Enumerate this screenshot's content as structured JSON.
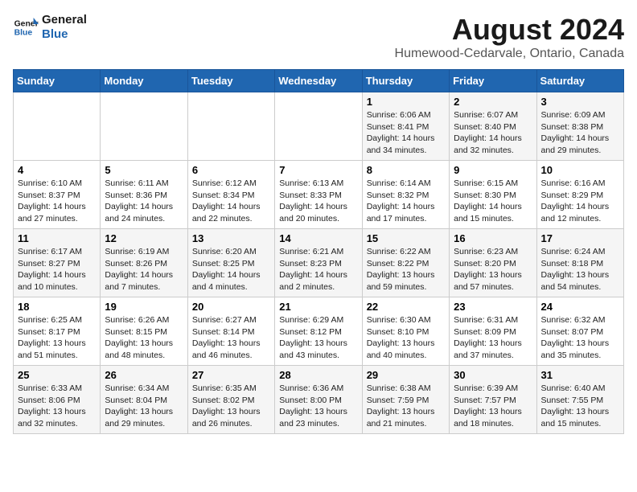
{
  "logo": {
    "line1": "General",
    "line2": "Blue"
  },
  "title": "August 2024",
  "subtitle": "Humewood-Cedarvale, Ontario, Canada",
  "days_of_week": [
    "Sunday",
    "Monday",
    "Tuesday",
    "Wednesday",
    "Thursday",
    "Friday",
    "Saturday"
  ],
  "weeks": [
    [
      {
        "day": "",
        "info": ""
      },
      {
        "day": "",
        "info": ""
      },
      {
        "day": "",
        "info": ""
      },
      {
        "day": "",
        "info": ""
      },
      {
        "day": "1",
        "info": "Sunrise: 6:06 AM\nSunset: 8:41 PM\nDaylight: 14 hours\nand 34 minutes."
      },
      {
        "day": "2",
        "info": "Sunrise: 6:07 AM\nSunset: 8:40 PM\nDaylight: 14 hours\nand 32 minutes."
      },
      {
        "day": "3",
        "info": "Sunrise: 6:09 AM\nSunset: 8:38 PM\nDaylight: 14 hours\nand 29 minutes."
      }
    ],
    [
      {
        "day": "4",
        "info": "Sunrise: 6:10 AM\nSunset: 8:37 PM\nDaylight: 14 hours\nand 27 minutes."
      },
      {
        "day": "5",
        "info": "Sunrise: 6:11 AM\nSunset: 8:36 PM\nDaylight: 14 hours\nand 24 minutes."
      },
      {
        "day": "6",
        "info": "Sunrise: 6:12 AM\nSunset: 8:34 PM\nDaylight: 14 hours\nand 22 minutes."
      },
      {
        "day": "7",
        "info": "Sunrise: 6:13 AM\nSunset: 8:33 PM\nDaylight: 14 hours\nand 20 minutes."
      },
      {
        "day": "8",
        "info": "Sunrise: 6:14 AM\nSunset: 8:32 PM\nDaylight: 14 hours\nand 17 minutes."
      },
      {
        "day": "9",
        "info": "Sunrise: 6:15 AM\nSunset: 8:30 PM\nDaylight: 14 hours\nand 15 minutes."
      },
      {
        "day": "10",
        "info": "Sunrise: 6:16 AM\nSunset: 8:29 PM\nDaylight: 14 hours\nand 12 minutes."
      }
    ],
    [
      {
        "day": "11",
        "info": "Sunrise: 6:17 AM\nSunset: 8:27 PM\nDaylight: 14 hours\nand 10 minutes."
      },
      {
        "day": "12",
        "info": "Sunrise: 6:19 AM\nSunset: 8:26 PM\nDaylight: 14 hours\nand 7 minutes."
      },
      {
        "day": "13",
        "info": "Sunrise: 6:20 AM\nSunset: 8:25 PM\nDaylight: 14 hours\nand 4 minutes."
      },
      {
        "day": "14",
        "info": "Sunrise: 6:21 AM\nSunset: 8:23 PM\nDaylight: 14 hours\nand 2 minutes."
      },
      {
        "day": "15",
        "info": "Sunrise: 6:22 AM\nSunset: 8:22 PM\nDaylight: 13 hours\nand 59 minutes."
      },
      {
        "day": "16",
        "info": "Sunrise: 6:23 AM\nSunset: 8:20 PM\nDaylight: 13 hours\nand 57 minutes."
      },
      {
        "day": "17",
        "info": "Sunrise: 6:24 AM\nSunset: 8:18 PM\nDaylight: 13 hours\nand 54 minutes."
      }
    ],
    [
      {
        "day": "18",
        "info": "Sunrise: 6:25 AM\nSunset: 8:17 PM\nDaylight: 13 hours\nand 51 minutes."
      },
      {
        "day": "19",
        "info": "Sunrise: 6:26 AM\nSunset: 8:15 PM\nDaylight: 13 hours\nand 48 minutes."
      },
      {
        "day": "20",
        "info": "Sunrise: 6:27 AM\nSunset: 8:14 PM\nDaylight: 13 hours\nand 46 minutes."
      },
      {
        "day": "21",
        "info": "Sunrise: 6:29 AM\nSunset: 8:12 PM\nDaylight: 13 hours\nand 43 minutes."
      },
      {
        "day": "22",
        "info": "Sunrise: 6:30 AM\nSunset: 8:10 PM\nDaylight: 13 hours\nand 40 minutes."
      },
      {
        "day": "23",
        "info": "Sunrise: 6:31 AM\nSunset: 8:09 PM\nDaylight: 13 hours\nand 37 minutes."
      },
      {
        "day": "24",
        "info": "Sunrise: 6:32 AM\nSunset: 8:07 PM\nDaylight: 13 hours\nand 35 minutes."
      }
    ],
    [
      {
        "day": "25",
        "info": "Sunrise: 6:33 AM\nSunset: 8:06 PM\nDaylight: 13 hours\nand 32 minutes."
      },
      {
        "day": "26",
        "info": "Sunrise: 6:34 AM\nSunset: 8:04 PM\nDaylight: 13 hours\nand 29 minutes."
      },
      {
        "day": "27",
        "info": "Sunrise: 6:35 AM\nSunset: 8:02 PM\nDaylight: 13 hours\nand 26 minutes."
      },
      {
        "day": "28",
        "info": "Sunrise: 6:36 AM\nSunset: 8:00 PM\nDaylight: 13 hours\nand 23 minutes."
      },
      {
        "day": "29",
        "info": "Sunrise: 6:38 AM\nSunset: 7:59 PM\nDaylight: 13 hours\nand 21 minutes."
      },
      {
        "day": "30",
        "info": "Sunrise: 6:39 AM\nSunset: 7:57 PM\nDaylight: 13 hours\nand 18 minutes."
      },
      {
        "day": "31",
        "info": "Sunrise: 6:40 AM\nSunset: 7:55 PM\nDaylight: 13 hours\nand 15 minutes."
      }
    ]
  ]
}
